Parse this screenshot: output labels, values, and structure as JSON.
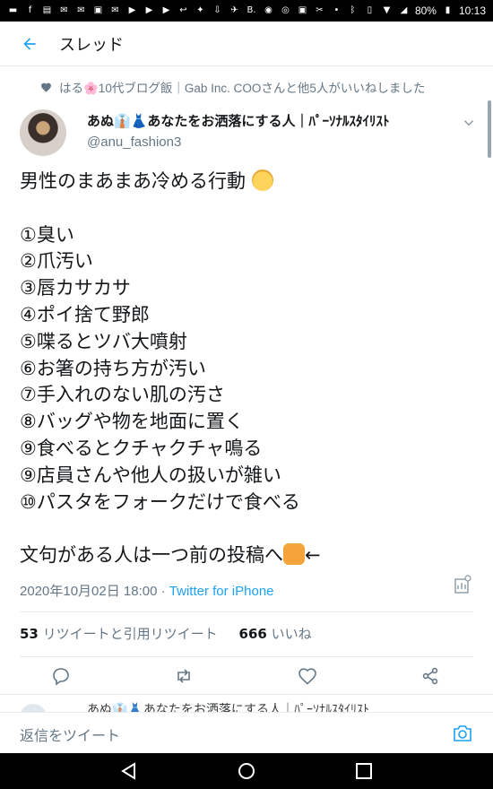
{
  "status_bar": {
    "battery": "80%",
    "time": "10:13"
  },
  "header": {
    "title": "スレッド"
  },
  "social_context": {
    "text": "はる🌸10代ブログ飯｜Gab Inc. COOさんと他5人がいいねしました"
  },
  "author": {
    "display_name": "あぬ👔👗あなたをお洒落にする人｜ﾊﾟｰｿﾅﾙｽﾀｲﾘｽﾄ",
    "handle": "@anu_fashion3"
  },
  "tweet": {
    "headline": "男性のまあまあ冷める行動",
    "items": [
      "①臭い",
      "②爪汚い",
      "③唇カサカサ",
      "④ポイ捨て野郎",
      "⑤喋るとツバ大噴射",
      "⑥お箸の持ち方が汚い",
      "⑦手入れのない肌の汚さ",
      "⑧バッグや物を地面に置く",
      "⑨食べるとクチャクチャ鳴る",
      "⑨店員さんや他人の扱いが雑い",
      "⑩パスタをフォークだけで食べる"
    ],
    "closing": "文句がある人は一つ前の投稿へ",
    "closing_suffix": "←"
  },
  "meta": {
    "datetime": "2020年10月02日 18:00",
    "separator": " · ",
    "source": "Twitter for iPhone"
  },
  "stats": {
    "retweets_count": "53",
    "retweets_label": "リツイートと引用リツイート",
    "likes_count": "666",
    "likes_label": "いいね"
  },
  "next_tweet": {
    "preview": "あぬ👔👗あなたをお洒落にする人｜ﾊﾟｰｿﾅﾙｽﾀｲﾘｽﾄ"
  },
  "reply_bar": {
    "placeholder": "返信をツイート"
  },
  "colors": {
    "accent": "#1da1f2",
    "secondary_text": "#657786",
    "divider": "#e6ecf0"
  }
}
